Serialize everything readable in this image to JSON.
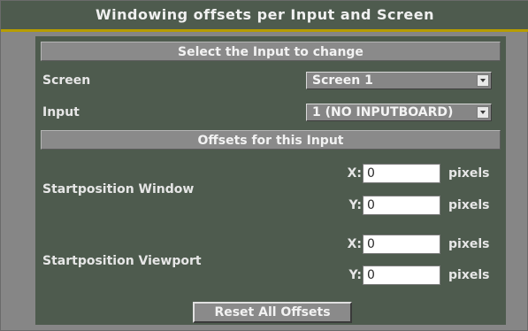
{
  "window": {
    "title": "Windowing offsets per Input and Screen"
  },
  "select_section": {
    "header": "Select the Input to change",
    "screen": {
      "label": "Screen",
      "selected": "Screen 1"
    },
    "input": {
      "label": "Input",
      "selected": "1 (NO INPUTBOARD)"
    }
  },
  "offsets_section": {
    "header": "Offsets for this Input",
    "window": {
      "label": "Startposition Window",
      "x_label": "X:",
      "x_value": "0",
      "y_label": "Y:",
      "y_value": "0",
      "unit": "pixels"
    },
    "viewport": {
      "label": "Startposition Viewport",
      "x_label": "X:",
      "x_value": "0",
      "y_label": "Y:",
      "y_value": "0",
      "unit": "pixels"
    }
  },
  "reset_button": "Reset All Offsets",
  "colors": {
    "panel_bg": "#4e5b4e",
    "frame_bg": "#868686",
    "accent_line": "#b79d00",
    "section_header_bg": "#8a8a8a"
  },
  "icons": [
    "chevron-down-icon"
  ]
}
